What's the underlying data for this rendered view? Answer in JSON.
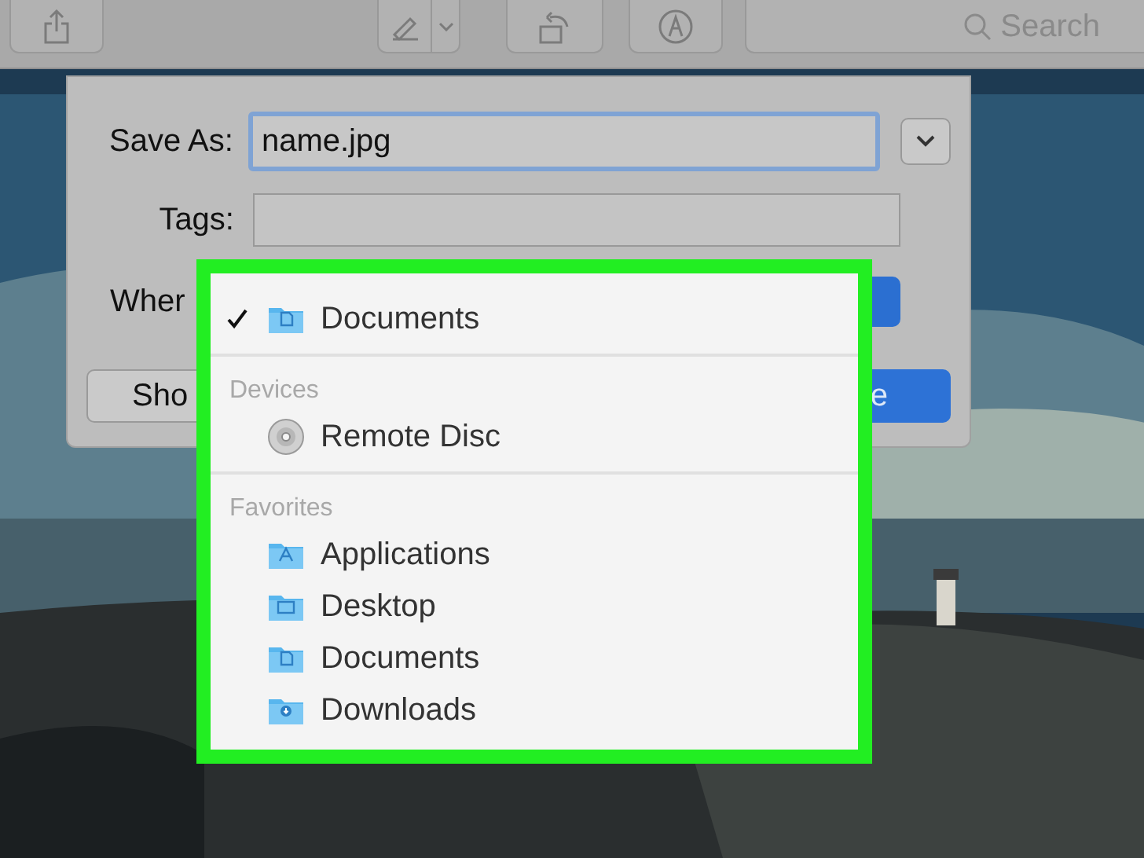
{
  "toolbar": {
    "search": {
      "placeholder": "Search"
    }
  },
  "dialog": {
    "save_as": {
      "label": "Save As:",
      "value": "name.jpg"
    },
    "tags": {
      "label": "Tags:"
    },
    "where": {
      "label": "Wher"
    },
    "buttons": [
      {
        "label": "Sho",
        "kind": "secondary"
      },
      {
        "label": "e",
        "kind": "primary"
      }
    ]
  },
  "menu": {
    "sections": [
      {
        "items": [
          {
            "label": "Documents",
            "kind": "docs",
            "checked": true
          }
        ]
      },
      {
        "header": "Devices",
        "items": [
          {
            "label": "Remote Disc",
            "kind": "disc",
            "checked": false
          }
        ]
      },
      {
        "header": "Favorites",
        "items": [
          {
            "label": "Applications",
            "kind": "apps",
            "checked": false
          },
          {
            "label": "Desktop",
            "kind": "desktop",
            "checked": false
          },
          {
            "label": "Documents",
            "kind": "docs",
            "checked": false
          },
          {
            "label": "Downloads",
            "kind": "downloads",
            "checked": false
          }
        ]
      }
    ]
  }
}
